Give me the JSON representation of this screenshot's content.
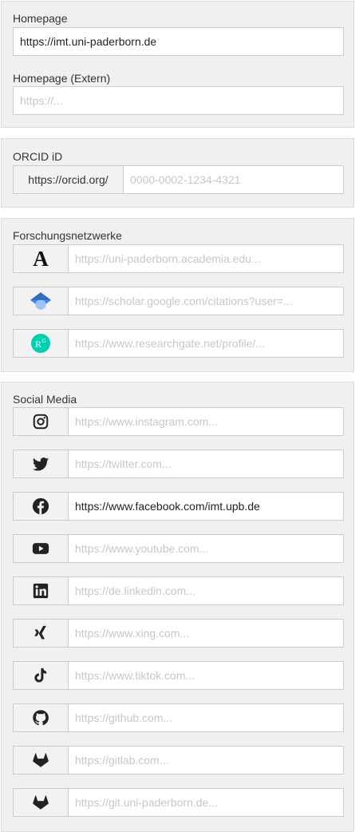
{
  "homepage": {
    "label": "Homepage",
    "value": "https://imt.uni-paderborn.de",
    "extern_label": "Homepage (Extern)",
    "extern_placeholder": "https://..."
  },
  "orcid": {
    "label": "ORCID iD",
    "prefix": "https://orcid.org/",
    "placeholder": "0000-0002-1234-4321"
  },
  "research": {
    "label": "Forschungsnetzwerke",
    "items": [
      {
        "icon": "academia-icon",
        "placeholder": "https://uni-paderborn.academia.edu..."
      },
      {
        "icon": "google-scholar-icon",
        "placeholder": "https://scholar.google.com/citations?user=..."
      },
      {
        "icon": "researchgate-icon",
        "placeholder": "https://www.researchgate.net/profile/..."
      }
    ]
  },
  "social": {
    "label": "Social Media",
    "items": [
      {
        "icon": "instagram-icon",
        "placeholder": "https://www.instagram.com..."
      },
      {
        "icon": "twitter-icon",
        "placeholder": "https://twitter.com..."
      },
      {
        "icon": "facebook-icon",
        "value": "https://www.facebook.com/imt.upb.de"
      },
      {
        "icon": "youtube-icon",
        "placeholder": "https://www.youtube.com..."
      },
      {
        "icon": "linkedin-icon",
        "placeholder": "https://de.linkedin.com..."
      },
      {
        "icon": "xing-icon",
        "placeholder": "https://www.xing.com..."
      },
      {
        "icon": "tiktok-icon",
        "placeholder": "https://www.tiktok.com..."
      },
      {
        "icon": "github-icon",
        "placeholder": "https://github.com..."
      },
      {
        "icon": "gitlab-icon",
        "placeholder": "https://gitlab.com..."
      },
      {
        "icon": "gitlab-icon",
        "placeholder": "https://git.uni-paderborn.de..."
      }
    ]
  },
  "colors": {
    "panel_bg": "#f0f0f0",
    "scholar_blue": "#4285f4",
    "researchgate_teal": "#00d0af"
  }
}
